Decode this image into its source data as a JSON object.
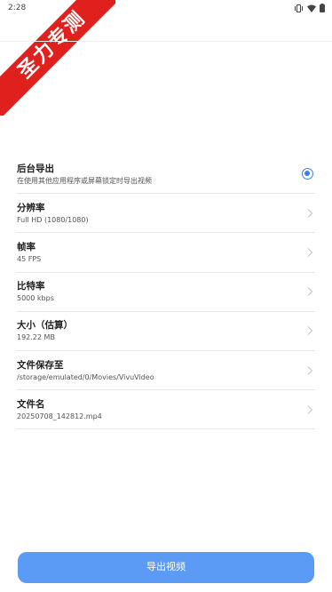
{
  "status_bar": {
    "time": "2:28",
    "icons": [
      "vibrate-icon",
      "wifi-icon",
      "battery-icon"
    ]
  },
  "ribbon": {
    "text": "圣力专测",
    "color": "#e0201c"
  },
  "settings": {
    "background_export": {
      "title": "后台导出",
      "subtitle": "在使用其他应用程序或屏幕锁定时导出视频",
      "selected": true
    },
    "resolution": {
      "title": "分辨率",
      "value": "Full HD (1080/1080)"
    },
    "frame_rate": {
      "title": "帧率",
      "value": "45 FPS"
    },
    "bit_rate": {
      "title": "比特率",
      "value": "5000 kbps"
    },
    "size": {
      "title": "大小（估算）",
      "value": "192.22 MB"
    },
    "save_location": {
      "title": "文件保存至",
      "value": "/storage/emulated/0/Movies/VivuVideo"
    },
    "file_name": {
      "title": "文件名",
      "value": "20250708_142812.mp4"
    }
  },
  "export_button": {
    "label": "导出视频",
    "color": "#5b9bf5"
  },
  "accent_color": "#3f7ef0"
}
